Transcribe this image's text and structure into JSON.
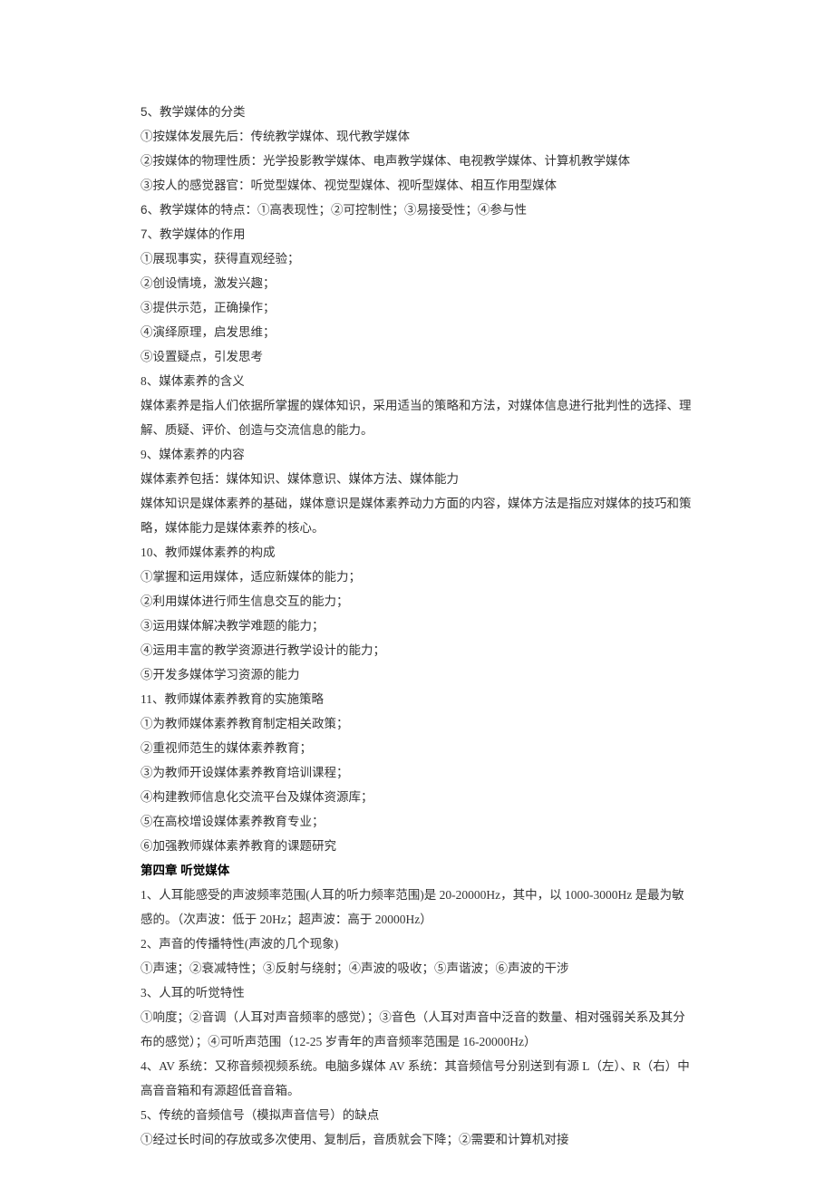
{
  "lines": [
    {
      "text": "5、教学媒体的分类",
      "sans": true
    },
    {
      "text": "①按媒体发展先后：传统教学媒体、现代教学媒体"
    },
    {
      "text": "②按媒体的物理性质：光学投影教学媒体、电声教学媒体、电视教学媒体、计算机教学媒体"
    },
    {
      "text": "③按人的感觉器官：听觉型媒体、视觉型媒体、视听型媒体、相互作用型媒体"
    },
    {
      "text": "6、教学媒体的特点：①高表现性；②可控制性；③易接受性；④参与性",
      "sans": true
    },
    {
      "text": "7、教学媒体的作用",
      "sans": true
    },
    {
      "text": "①展现事实，获得直观经验；"
    },
    {
      "text": "②创设情境，激发兴趣；"
    },
    {
      "text": "③提供示范，正确操作；"
    },
    {
      "text": "④演绎原理，启发思维；"
    },
    {
      "text": "⑤设置疑点，引发思考"
    },
    {
      "text": "8、媒体素养的含义"
    },
    {
      "text": "媒体素养是指人们依据所掌握的媒体知识，采用适当的策略和方法，对媒体信息进行批判性的选择、理解、质疑、评价、创造与交流信息的能力。"
    },
    {
      "text": "9、媒体素养的内容"
    },
    {
      "text": "媒体素养包括：媒体知识、媒体意识、媒体方法、媒体能力"
    },
    {
      "text": "媒体知识是媒体素养的基础，媒体意识是媒体素养动力方面的内容，媒体方法是指应对媒体的技巧和策略，媒体能力是媒体素养的核心。"
    },
    {
      "text": "10、教师媒体素养的构成"
    },
    {
      "text": "①掌握和运用媒体，适应新媒体的能力；"
    },
    {
      "text": "②利用媒体进行师生信息交互的能力；"
    },
    {
      "text": "③运用媒体解决教学难题的能力；"
    },
    {
      "text": "④运用丰富的教学资源进行教学设计的能力；"
    },
    {
      "text": "⑤开发多媒体学习资源的能力"
    },
    {
      "text": "11、教师媒体素养教育的实施策略"
    },
    {
      "text": "①为教师媒体素养教育制定相关政策；"
    },
    {
      "text": "②重视师范生的媒体素养教育；"
    },
    {
      "text": "③为教师开设媒体素养教育培训课程；"
    },
    {
      "text": "④构建教师信息化交流平台及媒体资源库；"
    },
    {
      "text": "⑤在高校增设媒体素养教育专业；"
    },
    {
      "text": "⑥加强教师媒体素养教育的课题研究"
    },
    {
      "text": "第四章 听觉媒体",
      "bold": true,
      "sans": true
    },
    {
      "text": "1、人耳能感受的声波频率范围(人耳的听力频率范围)是 20-20000Hz，其中，以 1000-3000Hz 是最为敏感的。（次声波：低于 20Hz；超声波：高于 20000Hz）"
    },
    {
      "text": "2、声音的传播特性(声波的几个现象)"
    },
    {
      "text": "①声速；②衰减特性；③反射与绕射；④声波的吸收；⑤声谐波；⑥声波的干涉"
    },
    {
      "text": "3、人耳的听觉特性"
    },
    {
      "text": "①响度；②音调（人耳对声音频率的感觉）；③音色（人耳对声音中泛音的数量、相对强弱关系及其分布的感觉）；④可听声范围（12-25 岁青年的声音频率范围是 16-20000Hz）"
    },
    {
      "text": "4、AV 系统：又称音频视频系统。电脑多媒体 AV 系统：其音频信号分别送到有源 L（左）、R（右）中高音音箱和有源超低音音箱。"
    },
    {
      "text": "5、传统的音频信号（模拟声音信号）的缺点"
    },
    {
      "text": "①经过长时间的存放或多次使用、复制后，音质就会下降；②需要和计算机对接"
    }
  ]
}
